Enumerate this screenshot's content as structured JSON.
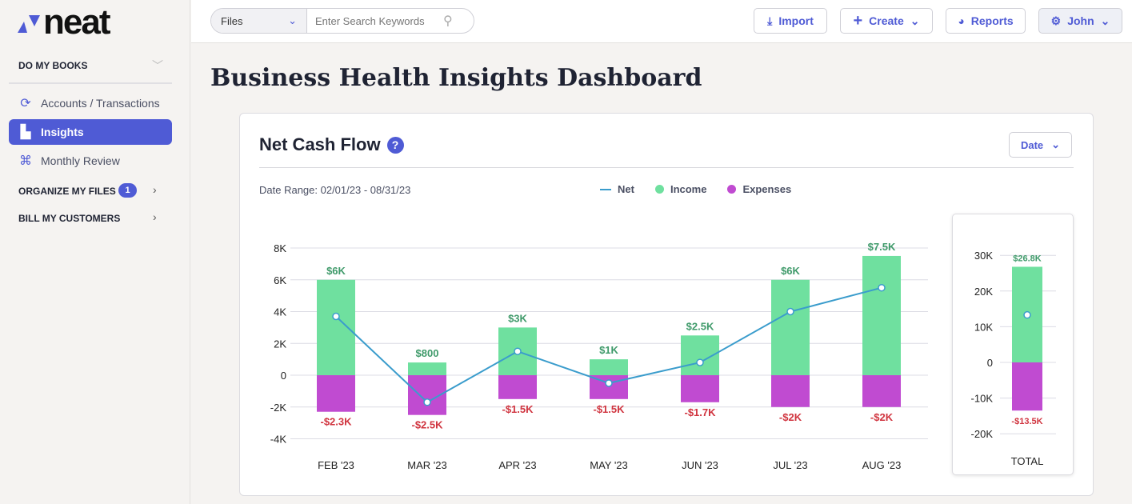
{
  "logo": {
    "text": "neat"
  },
  "sidebar": {
    "sections": [
      {
        "label": "DO MY BOOKS"
      },
      {
        "label": "ORGANIZE MY FILES",
        "badge": "1"
      },
      {
        "label": "BILL MY CUSTOMERS"
      }
    ],
    "items": [
      {
        "label": "Accounts / Transactions",
        "icon": "refresh-icon"
      },
      {
        "label": "Insights",
        "icon": "bar-chart-icon",
        "active": true
      },
      {
        "label": "Monthly Review",
        "icon": "command-icon"
      }
    ]
  },
  "header": {
    "search_scope": "Files",
    "search_placeholder": "Enter Search Keywords",
    "import": "Import",
    "create": "Create",
    "reports": "Reports",
    "user": "John"
  },
  "page": {
    "title": "Business Health Insights Dashboard"
  },
  "card": {
    "title": "Net Cash Flow",
    "help": "?",
    "date_button": "Date",
    "date_range": "Date Range: 02/01/23 - 08/31/23"
  },
  "colors": {
    "accent": "#4f5bd5",
    "income": "#6fe09f",
    "expenses": "#c04bd1",
    "net": "#3a9ccc",
    "income_label": "#3f9a6a",
    "expense_label": "#d0343f"
  },
  "chart_data": [
    {
      "type": "bar",
      "categories": [
        "FEB '23",
        "MAR '23",
        "APR '23",
        "MAY '23",
        "JUN '23",
        "JUL '23",
        "AUG '23"
      ],
      "yticks": [
        "8K",
        "6K",
        "4K",
        "2K",
        "0",
        "-2K",
        "-4K"
      ],
      "ylim": [
        -4000,
        8000
      ],
      "legend": [
        "Net",
        "Income",
        "Expenses"
      ],
      "legend_position": "top",
      "grid": true,
      "series": [
        {
          "name": "Income",
          "type": "bar",
          "values": [
            6000,
            800,
            3000,
            1000,
            2500,
            6000,
            7500
          ],
          "labels": [
            "$6K",
            "$800",
            "$3K",
            "$1K",
            "$2.5K",
            "$6K",
            "$7.5K"
          ]
        },
        {
          "name": "Expenses",
          "type": "bar",
          "values": [
            -2300,
            -2500,
            -1500,
            -1500,
            -1700,
            -2000,
            -2000
          ],
          "labels": [
            "-$2.3K",
            "-$2.5K",
            "-$1.5K",
            "-$1.5K",
            "-$1.7K",
            "-$2K",
            "-$2K"
          ]
        },
        {
          "name": "Net",
          "type": "line",
          "values": [
            3700,
            -1700,
            1500,
            -500,
            800,
            4000,
            5500
          ]
        }
      ]
    },
    {
      "type": "bar",
      "categories": [
        "TOTAL"
      ],
      "yticks": [
        "30K",
        "20K",
        "10K",
        "0",
        "-10K",
        "-20K"
      ],
      "ylim": [
        -20000,
        30000
      ],
      "grid": true,
      "series": [
        {
          "name": "Income",
          "type": "bar",
          "values": [
            26800
          ],
          "labels": [
            "$26.8K"
          ]
        },
        {
          "name": "Expenses",
          "type": "bar",
          "values": [
            -13500
          ],
          "labels": [
            "-$13.5K"
          ]
        },
        {
          "name": "Net",
          "type": "line",
          "values": [
            13300
          ]
        }
      ]
    }
  ]
}
